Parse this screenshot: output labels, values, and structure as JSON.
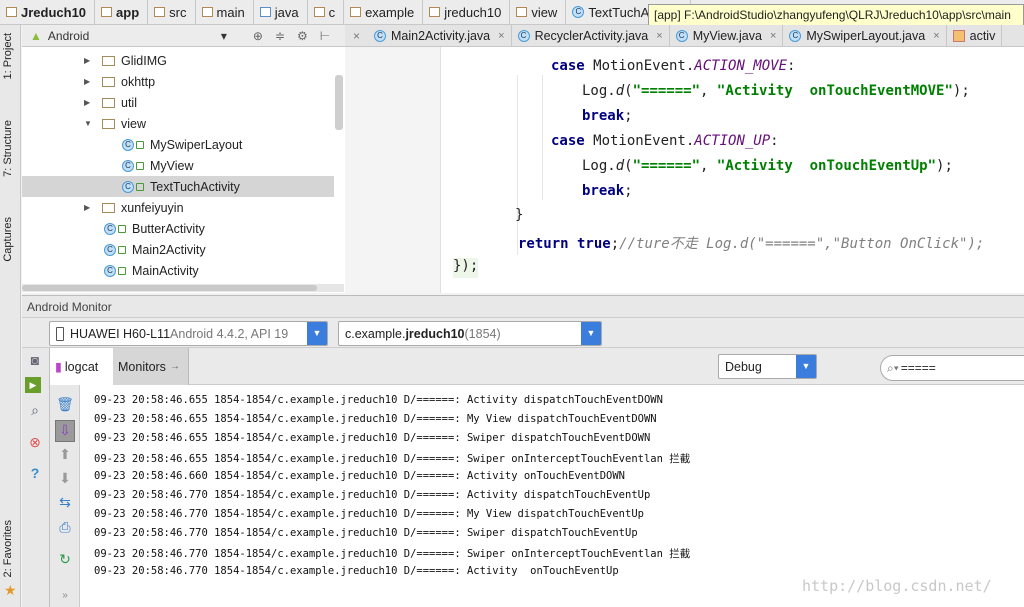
{
  "breadcrumbs": [
    {
      "label": "Jreduch10",
      "bold": true
    },
    {
      "label": "app",
      "bold": true
    },
    {
      "label": "src"
    },
    {
      "label": "main"
    },
    {
      "label": "java"
    },
    {
      "label": "c"
    },
    {
      "label": "example"
    },
    {
      "label": "jreduch10"
    },
    {
      "label": "view"
    },
    {
      "label": "TextTuchActivity"
    }
  ],
  "tooltip": "[app] F:\\AndroidStudio\\zhangyufeng\\QLRJ\\Jreduch10\\app\\src\\main",
  "left_strip": {
    "project": "1: Project",
    "structure": "7: Structure",
    "captures": "Captures",
    "favorites": "2: Favorites"
  },
  "project": {
    "view_mode": "Android",
    "tree": [
      {
        "label": "GlidIMG",
        "type": "folder",
        "collapsed": true
      },
      {
        "label": "okhttp",
        "type": "folder",
        "collapsed": true
      },
      {
        "label": "util",
        "type": "folder",
        "collapsed": true
      },
      {
        "label": "view",
        "type": "folder",
        "collapsed": false
      },
      {
        "label": "MySwiperLayout",
        "type": "class",
        "indent": 2
      },
      {
        "label": "MyView",
        "type": "class",
        "indent": 2
      },
      {
        "label": "TextTuchActivity",
        "type": "class",
        "indent": 2,
        "selected": true
      },
      {
        "label": "xunfeiyuyin",
        "type": "folder",
        "collapsed": true
      },
      {
        "label": "ButterActivity",
        "type": "class",
        "indent": 1
      },
      {
        "label": "Main2Activity",
        "type": "class",
        "indent": 1
      },
      {
        "label": "MainActivity",
        "type": "class",
        "indent": 1
      }
    ]
  },
  "editor_tabs": [
    "Main2Activity.java",
    "RecyclerActivity.java",
    "MyView.java",
    "MySwiperLayout.java",
    "activ"
  ],
  "code": {
    "l1": {
      "kw": "case",
      "a": " MotionEvent.",
      "c": "ACTION_MOVE",
      ":": ":"
    },
    "l2": {
      "a": "Log.",
      "m": "d",
      "b": "(",
      "s1": "\"======\"",
      ",": ", ",
      "s2": "\"Activity  onTouchEventMOVE\"",
      "e": ");"
    },
    "l3": {
      "kw": "break",
      ";": ";"
    },
    "l4": {
      "kw": "case",
      "a": " MotionEvent.",
      "c": "ACTION_UP",
      ":": ":"
    },
    "l5": {
      "a": "Log.",
      "m": "d",
      "b": "(",
      "s1": "\"======\"",
      ",": ", ",
      "s2": "\"Activity  onTouchEventUp\"",
      "e": ");"
    },
    "l6": {
      "kw": "break",
      ";": ";"
    },
    "l7": "}",
    "l8": {
      "kw": "return true",
      ";": ";",
      "cm": "//ture不走 Log.d(\"======\",\"Button OnClick\");"
    },
    "l9": "});"
  },
  "monitor": {
    "title": "Android Monitor",
    "device_name": "HUAWEI H60-L11",
    "device_info": " Android 4.4.2, API 19",
    "process_prefix": "c.example.",
    "process_bold": "jreduch10",
    "process_pid": " (1854)",
    "tab_logcat": "logcat",
    "tab_monitors": "Monitors",
    "log_level": "Debug",
    "search_value": "====="
  },
  "logs": [
    "09-23 20:58:46.655 1854-1854/c.example.jreduch10 D/======: Activity dispatchTouchEventDOWN",
    "09-23 20:58:46.655 1854-1854/c.example.jreduch10 D/======: My View dispatchTouchEventDOWN",
    "09-23 20:58:46.655 1854-1854/c.example.jreduch10 D/======: Swiper dispatchTouchEventDOWN",
    "09-23 20:58:46.655 1854-1854/c.example.jreduch10 D/======: Swiper onInterceptTouchEventlan 拦截",
    "09-23 20:58:46.660 1854-1854/c.example.jreduch10 D/======: Activity onTouchEventDOWN",
    "09-23 20:58:46.770 1854-1854/c.example.jreduch10 D/======: Activity dispatchTouchEventUp",
    "09-23 20:58:46.770 1854-1854/c.example.jreduch10 D/======: My View dispatchTouchEventUp",
    "09-23 20:58:46.770 1854-1854/c.example.jreduch10 D/======: Swiper dispatchTouchEventUp",
    "09-23 20:58:46.770 1854-1854/c.example.jreduch10 D/======: Swiper onInterceptTouchEventlan 拦截",
    "09-23 20:58:46.770 1854-1854/c.example.jreduch10 D/======: Activity  onTouchEventUp"
  ],
  "watermark": "http://blog.csdn.net/"
}
